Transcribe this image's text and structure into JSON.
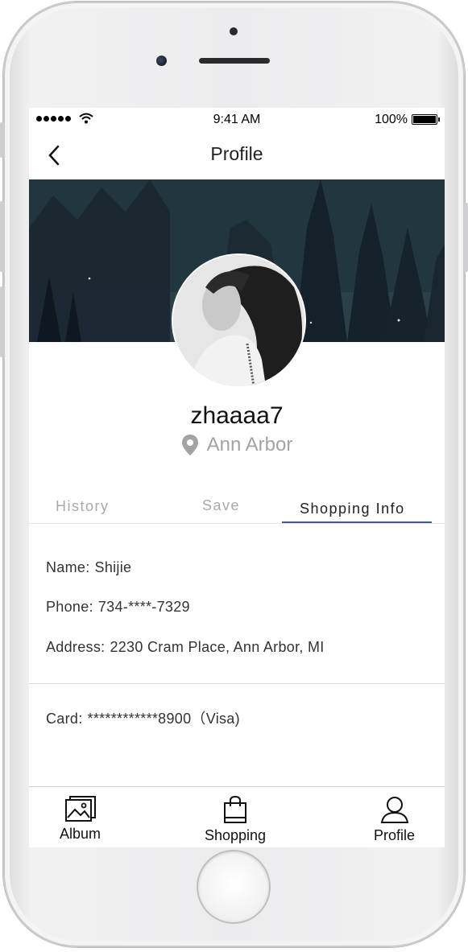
{
  "status_bar": {
    "time": "9:41 AM",
    "battery": "100%"
  },
  "nav": {
    "title": "Profile"
  },
  "profile": {
    "username": "zhaaaa7",
    "location": "Ann Arbor"
  },
  "tabs": [
    {
      "label": "History"
    },
    {
      "label": "Save"
    },
    {
      "label": "Shopping Info",
      "active": true
    }
  ],
  "shopping_info": {
    "name": {
      "label": "Name:",
      "value": "Shijie"
    },
    "phone": {
      "label": "Phone:",
      "value": "734-****-7329"
    },
    "address": {
      "label": "Address:",
      "value": "2230 Cram Place, Ann Arbor, MI"
    },
    "card": {
      "label": "Card:",
      "value": "************8900（Visa)"
    }
  },
  "bottom_tabs": [
    {
      "label": "Album",
      "icon": "album-icon"
    },
    {
      "label": "Shopping",
      "icon": "shopping-bag-icon"
    },
    {
      "label": "Profile",
      "icon": "profile-icon"
    }
  ],
  "colors": {
    "accent": "#3f5a8c",
    "muted_text": "#a9a9a9"
  }
}
